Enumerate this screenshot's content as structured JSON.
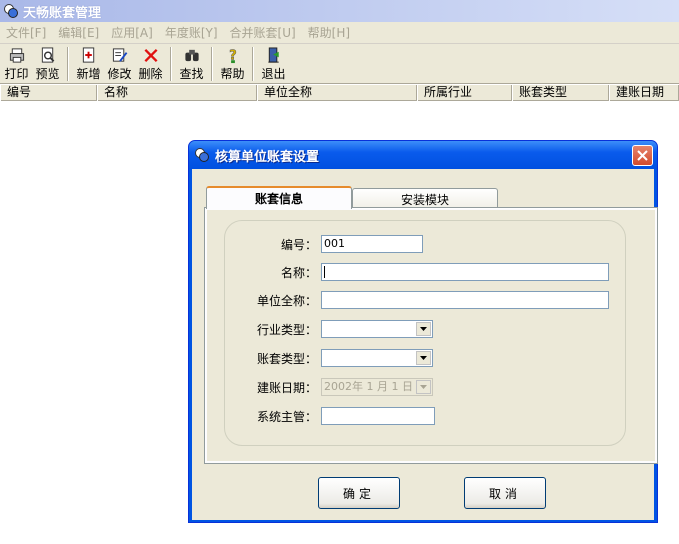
{
  "window": {
    "title": "天畅账套管理"
  },
  "menu": [
    {
      "label": "文件[F]"
    },
    {
      "label": "编辑[E]"
    },
    {
      "label": "应用[A]"
    },
    {
      "label": "年度账[Y]"
    },
    {
      "label": "合并账套[U]"
    },
    {
      "label": "帮助[H]"
    }
  ],
  "toolbar": {
    "print": "打印",
    "preview": "预览",
    "new": "新增",
    "edit": "修改",
    "delete": "删除",
    "find": "查找",
    "help": "帮助",
    "exit": "退出"
  },
  "list": {
    "columns": [
      "编号",
      "名称",
      "单位全称",
      "所属行业",
      "账套类型",
      "建账日期"
    ]
  },
  "dialog": {
    "title": "核算单位账套设置",
    "tabs": [
      "账套信息",
      "安装模块"
    ],
    "fields": {
      "code_label": "编号：",
      "code_value": "001",
      "name_label": "名称：",
      "name_value": "",
      "fullname_label": "单位全称：",
      "fullname_value": "",
      "industry_label": "行业类型：",
      "industry_value": "",
      "type_label": "账套类型：",
      "type_value": "",
      "date_label": "建账日期：",
      "date_value": "2002年 1 月 1 日",
      "admin_label": "系统主管：",
      "admin_value": ""
    },
    "ok": "确定",
    "cancel": "取消"
  },
  "colors": {
    "title_blue": "#0054e3",
    "close_red": "#d34a2c",
    "tab_accent": "#e68b2c"
  }
}
